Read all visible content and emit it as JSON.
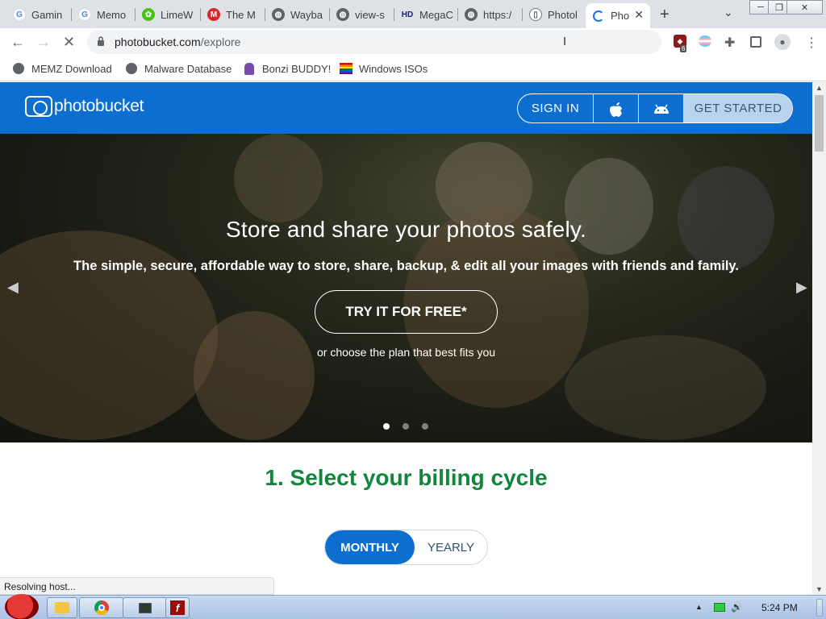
{
  "browser": {
    "tabs": [
      {
        "label": "Gamin",
        "favicon": "google-icon"
      },
      {
        "label": "Memo",
        "favicon": "google-icon"
      },
      {
        "label": "LimeW",
        "favicon": "limewire-icon"
      },
      {
        "label": "The M",
        "favicon": "mega-icon"
      },
      {
        "label": "Wayba",
        "favicon": "globe-icon"
      },
      {
        "label": "view-s",
        "favicon": "globe-icon"
      },
      {
        "label": "MegaC",
        "favicon": "hd-icon"
      },
      {
        "label": "https:/",
        "favicon": "globe-icon"
      },
      {
        "label": "Photol",
        "favicon": "photobucket-icon"
      },
      {
        "label": "Pho",
        "favicon": "loading-spinner"
      }
    ],
    "url_host": "photobucket.com",
    "url_path": "/explore",
    "extension_badge": "6",
    "bookmarks": [
      {
        "label": "MEMZ Download"
      },
      {
        "label": "Malware Database"
      },
      {
        "label": "Bonzi BUDDY!"
      },
      {
        "label": "Windows ISOs"
      }
    ],
    "status_text": "Resolving host..."
  },
  "site": {
    "logo_text": "photobucket",
    "nav": {
      "signin": "SIGN IN",
      "get_started": "GET STARTED"
    },
    "hero": {
      "title": "Store and share your photos safely.",
      "subtitle": "The simple, secure, affordable way to store, share, backup, & edit all your images with friends and family.",
      "cta": "TRY IT FOR FREE*",
      "plan_text": "or choose the plan that best fits you"
    },
    "billing": {
      "heading": "1. Select your billing cycle",
      "monthly": "MONTHLY",
      "yearly": "YEARLY"
    }
  },
  "taskbar": {
    "clock": "5:24 PM"
  },
  "colors": {
    "brand_blue": "#0c6fcf",
    "heading_green": "#13853d"
  }
}
